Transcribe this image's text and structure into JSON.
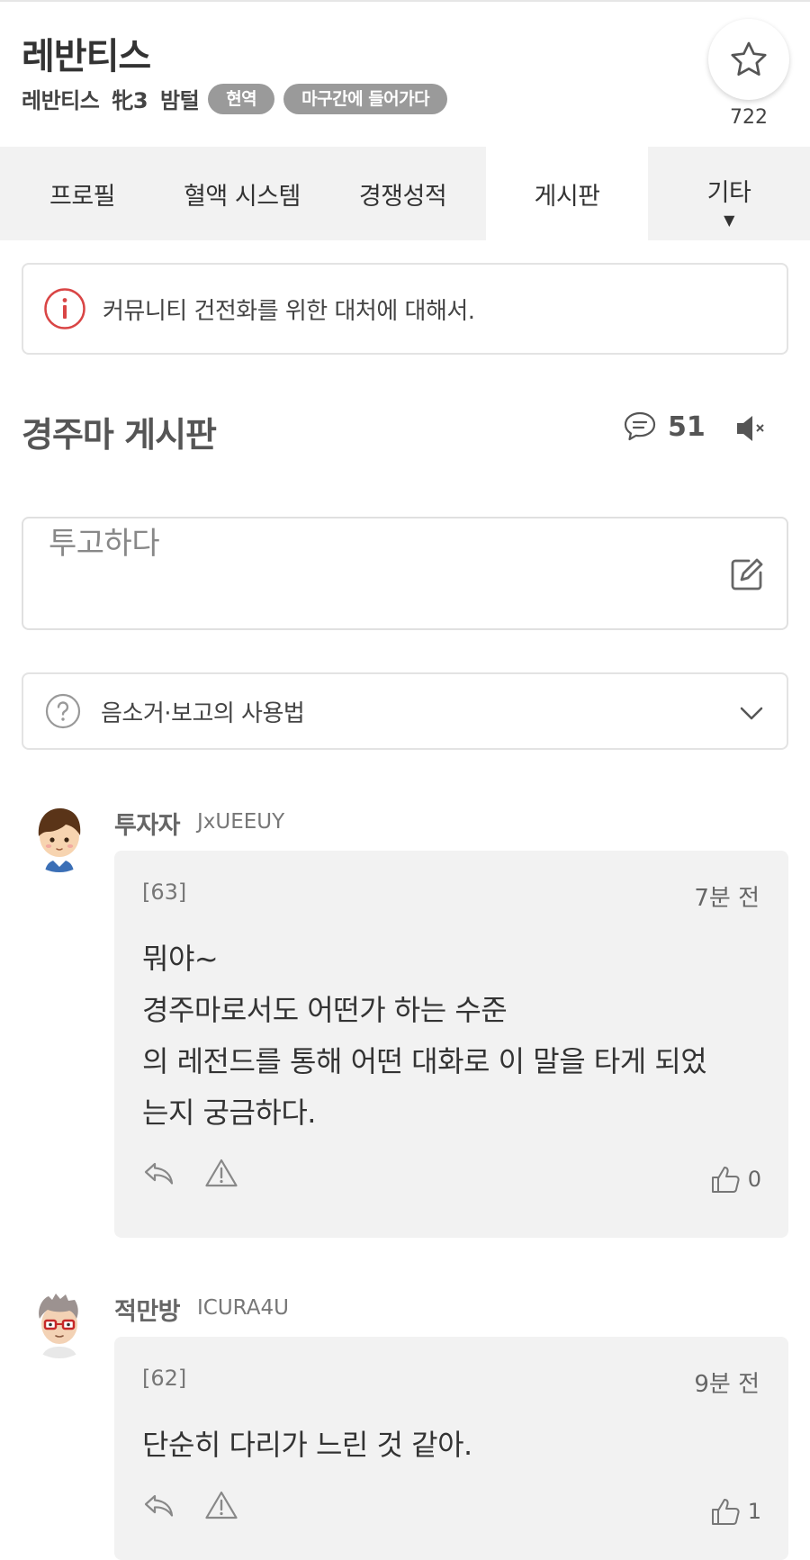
{
  "header": {
    "horse_name": "레반티스",
    "meta": [
      "레반티스",
      "牝3",
      "밤털"
    ],
    "badges": [
      "현역",
      "마구간에 들어가다"
    ],
    "favorite_count": "722"
  },
  "tabs": [
    {
      "label": "프로필",
      "active": false
    },
    {
      "label": "혈액 시스템",
      "active": false
    },
    {
      "label": "경쟁성적",
      "active": false
    },
    {
      "label": "게시판",
      "active": true
    },
    {
      "label": "기타",
      "active": false,
      "caret": "▼"
    }
  ],
  "notice": {
    "icon": "info-icon",
    "text": "커뮤니티 건전화를 위한 대처에 대해서."
  },
  "board": {
    "title": "경주마 게시판",
    "comment_count": "51"
  },
  "post": {
    "placeholder": "투고하다"
  },
  "help": {
    "icon": "question-icon",
    "text": "음소거·보고의 사용법"
  },
  "comments": [
    {
      "nickname": "투자자",
      "user_id": "JxUEEUY",
      "number": "[63]",
      "time": "7분 전",
      "lines": [
        "뭐야~",
        "경주마로서도 어떤가 하는 수준",
        "의 레전드를 통해 어떤 대화로 이 말을 타게 되었",
        "는지 궁금하다."
      ],
      "likes": "0"
    },
    {
      "nickname": "적만방",
      "user_id": "ICURA4U",
      "number": "[62]",
      "time": "9분 전",
      "lines": [
        "단순히 다리가 느린 것 같아."
      ],
      "likes": "1"
    }
  ],
  "colors": {
    "accent_red": "#d94545",
    "pill_gray": "#9a9a9a",
    "tab_bg": "#f2f2f2",
    "bubble_bg": "#f2f2f2"
  }
}
